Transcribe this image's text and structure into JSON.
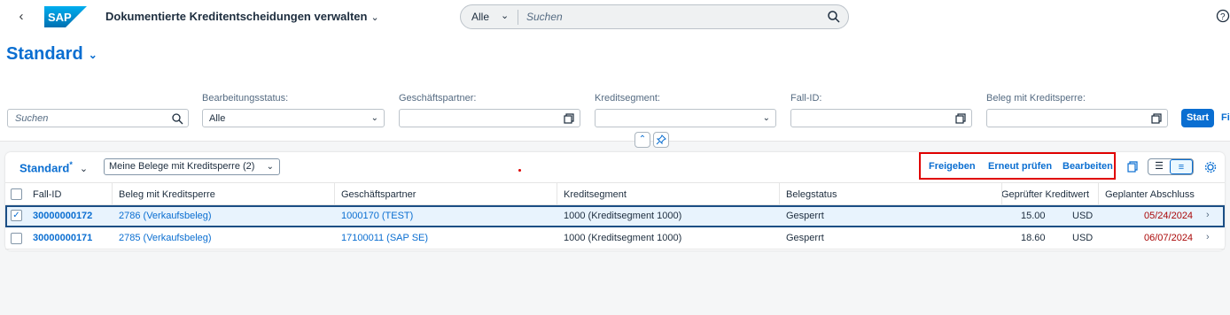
{
  "shell": {
    "back_icon": "back-arrow-icon",
    "logo_text": "SAP",
    "app_title": "Dokumentierte Kreditentscheidungen verwalten",
    "search_scope": "Alle",
    "search_placeholder": "Suchen",
    "help_icon": "help-icon"
  },
  "header": {
    "variant_title": "Standard",
    "filters": {
      "search_placeholder": "Suchen",
      "status_label": "Bearbeitungsstatus:",
      "status_value": "Alle",
      "partner_label": "Geschäftspartner:",
      "segment_label": "Kreditsegment:",
      "case_label": "Fall-ID:",
      "doc_label": "Beleg mit Kreditsperre:"
    },
    "start_label": "Start",
    "filter_label": "Fil"
  },
  "table": {
    "title": "Standard",
    "title_mark": "*",
    "variant_select": "Meine Belege mit Kreditsperre (2)",
    "actions": {
      "release": "Freigeben",
      "recheck": "Erneut prüfen",
      "edit": "Bearbeiten"
    },
    "columns": [
      "Fall-ID",
      "Beleg mit Kreditsperre",
      "Geschäftspartner",
      "Kreditsegment",
      "Belegstatus",
      "Geprüfter Kreditwert",
      "Geplanter Abschluss"
    ],
    "rows": [
      {
        "case_id": "30000000172",
        "doc": "2786 (Verkaufsbeleg)",
        "partner": "1000170 (TEST)",
        "segment": "1000 (Kreditsegment 1000)",
        "status": "Gesperrt",
        "amount": "15.00",
        "currency": "USD",
        "date": "05/24/2024",
        "selected": true
      },
      {
        "case_id": "30000000171",
        "doc": "2785 (Verkaufsbeleg)",
        "partner": "17100011 (SAP SE)",
        "segment": "1000 (Kreditsegment 1000)",
        "status": "Gesperrt",
        "amount": "18.60",
        "currency": "USD",
        "date": "06/07/2024",
        "selected": false
      }
    ]
  },
  "colors": {
    "brand_blue": "#0a6ed1",
    "highlight_red": "#e00000",
    "date_red": "#aa0808"
  }
}
